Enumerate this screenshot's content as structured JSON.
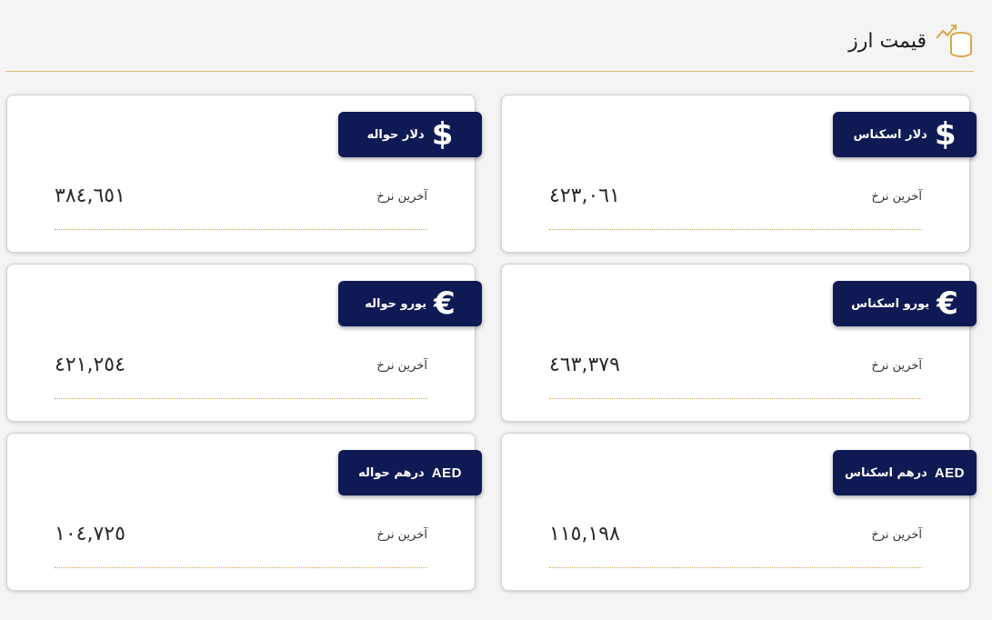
{
  "header": {
    "title": "قیمت ارز",
    "icon": "coins-growth-icon",
    "accent_color": "#d9bd7c"
  },
  "cards": [
    {
      "name": "dollar-cash",
      "symbol": "$",
      "code": "",
      "label": "دلار اسکناس",
      "rate_label": "آخرین نرخ",
      "value": "٤٢٣,٠٦١"
    },
    {
      "name": "dollar-transfer",
      "symbol": "$",
      "code": "",
      "label": "دلار حواله",
      "rate_label": "آخرین نرخ",
      "value": "٣٨٤,٦٥١"
    },
    {
      "name": "euro-cash",
      "symbol": "€",
      "code": "",
      "label": "یورو اسکناس",
      "rate_label": "آخرین نرخ",
      "value": "٤٦٣,٣٧٩"
    },
    {
      "name": "euro-transfer",
      "symbol": "€",
      "code": "",
      "label": "یورو حواله",
      "rate_label": "آخرین نرخ",
      "value": "٤٢١,٢٥٤"
    },
    {
      "name": "dirham-cash",
      "symbol": "",
      "code": "AED",
      "label": "درهم اسکناس",
      "rate_label": "آخرین نرخ",
      "value": "١١٥,١٩٨"
    },
    {
      "name": "dirham-transfer",
      "symbol": "",
      "code": "AED",
      "label": "درهم حواله",
      "rate_label": "آخرین نرخ",
      "value": "١٠٤,٧٢٥"
    }
  ],
  "colors": {
    "badge_bg": "#0f1a55",
    "page_bg": "#f4f4f4"
  }
}
